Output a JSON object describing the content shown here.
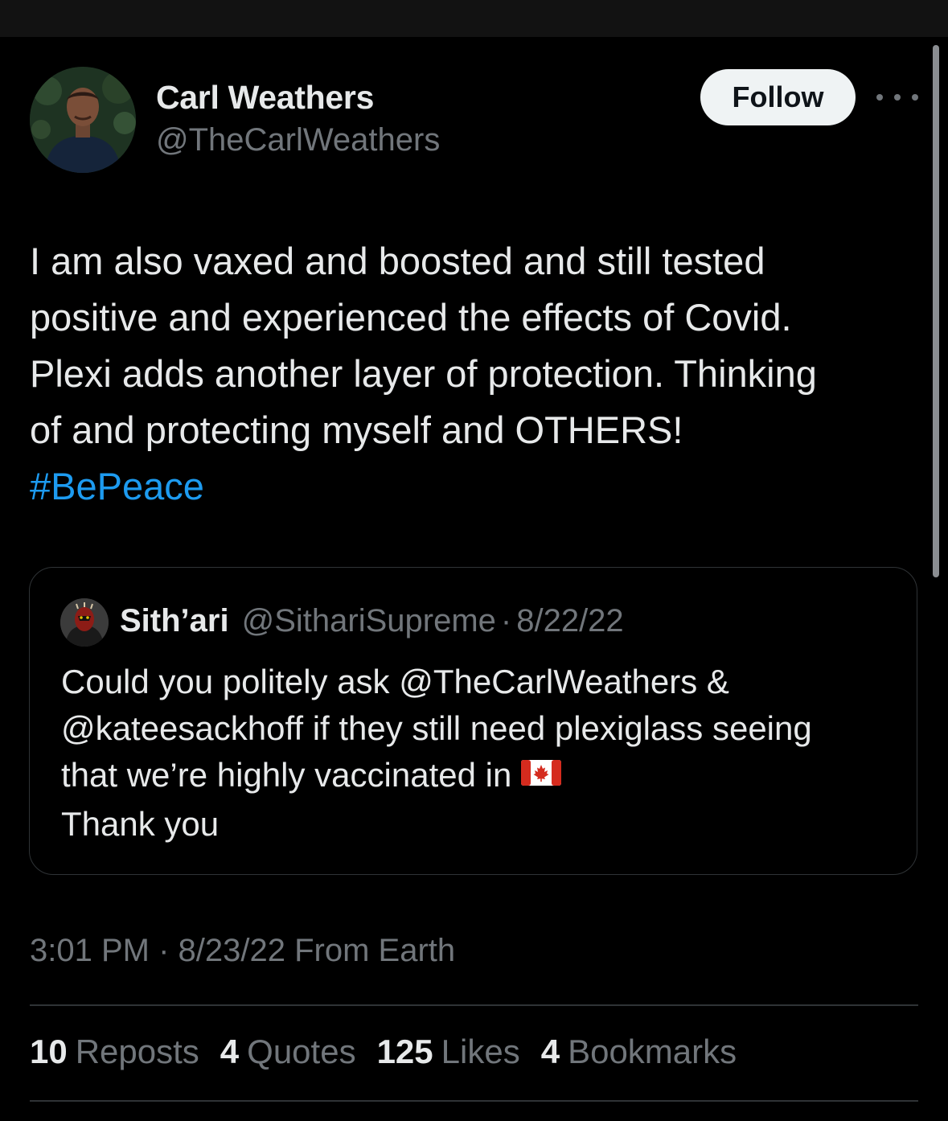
{
  "tweet": {
    "author": {
      "name": "Carl Weathers",
      "handle": "@TheCarlWeathers"
    },
    "follow_label": "Follow",
    "text_lines": [
      "I am also vaxed and boosted and still tested",
      "positive and experienced the effects of Covid.",
      "Plexi adds another layer of protection. Thinking",
      "of and protecting myself and OTHERS!"
    ],
    "hashtag": "#BePeace",
    "quoted": {
      "name": "Sith’ari",
      "handle": "@SithariSupreme",
      "separator": "·",
      "date": "8/22/22",
      "text_lines": [
        "Could you politely ask @TheCarlWeathers &",
        "@kateesackhoff if they still need plexiglass seeing",
        "that we’re highly vaccinated in",
        "Thank you"
      ],
      "flag_icon": "canada-flag-icon"
    },
    "meta": "3:01 PM · 8/23/22 From Earth",
    "stats": [
      {
        "count": "10",
        "label": "Reposts"
      },
      {
        "count": "4",
        "label": "Quotes"
      },
      {
        "count": "125",
        "label": "Likes"
      },
      {
        "count": "4",
        "label": "Bookmarks"
      }
    ]
  },
  "colors": {
    "background": "#000000",
    "text": "#e7e9ea",
    "secondary_text": "#71767b",
    "link": "#1d9bf0",
    "border": "#2f3336",
    "follow_button_bg": "#eff3f4"
  },
  "icons": [
    "more-options-icon",
    "canada-flag-icon"
  ]
}
